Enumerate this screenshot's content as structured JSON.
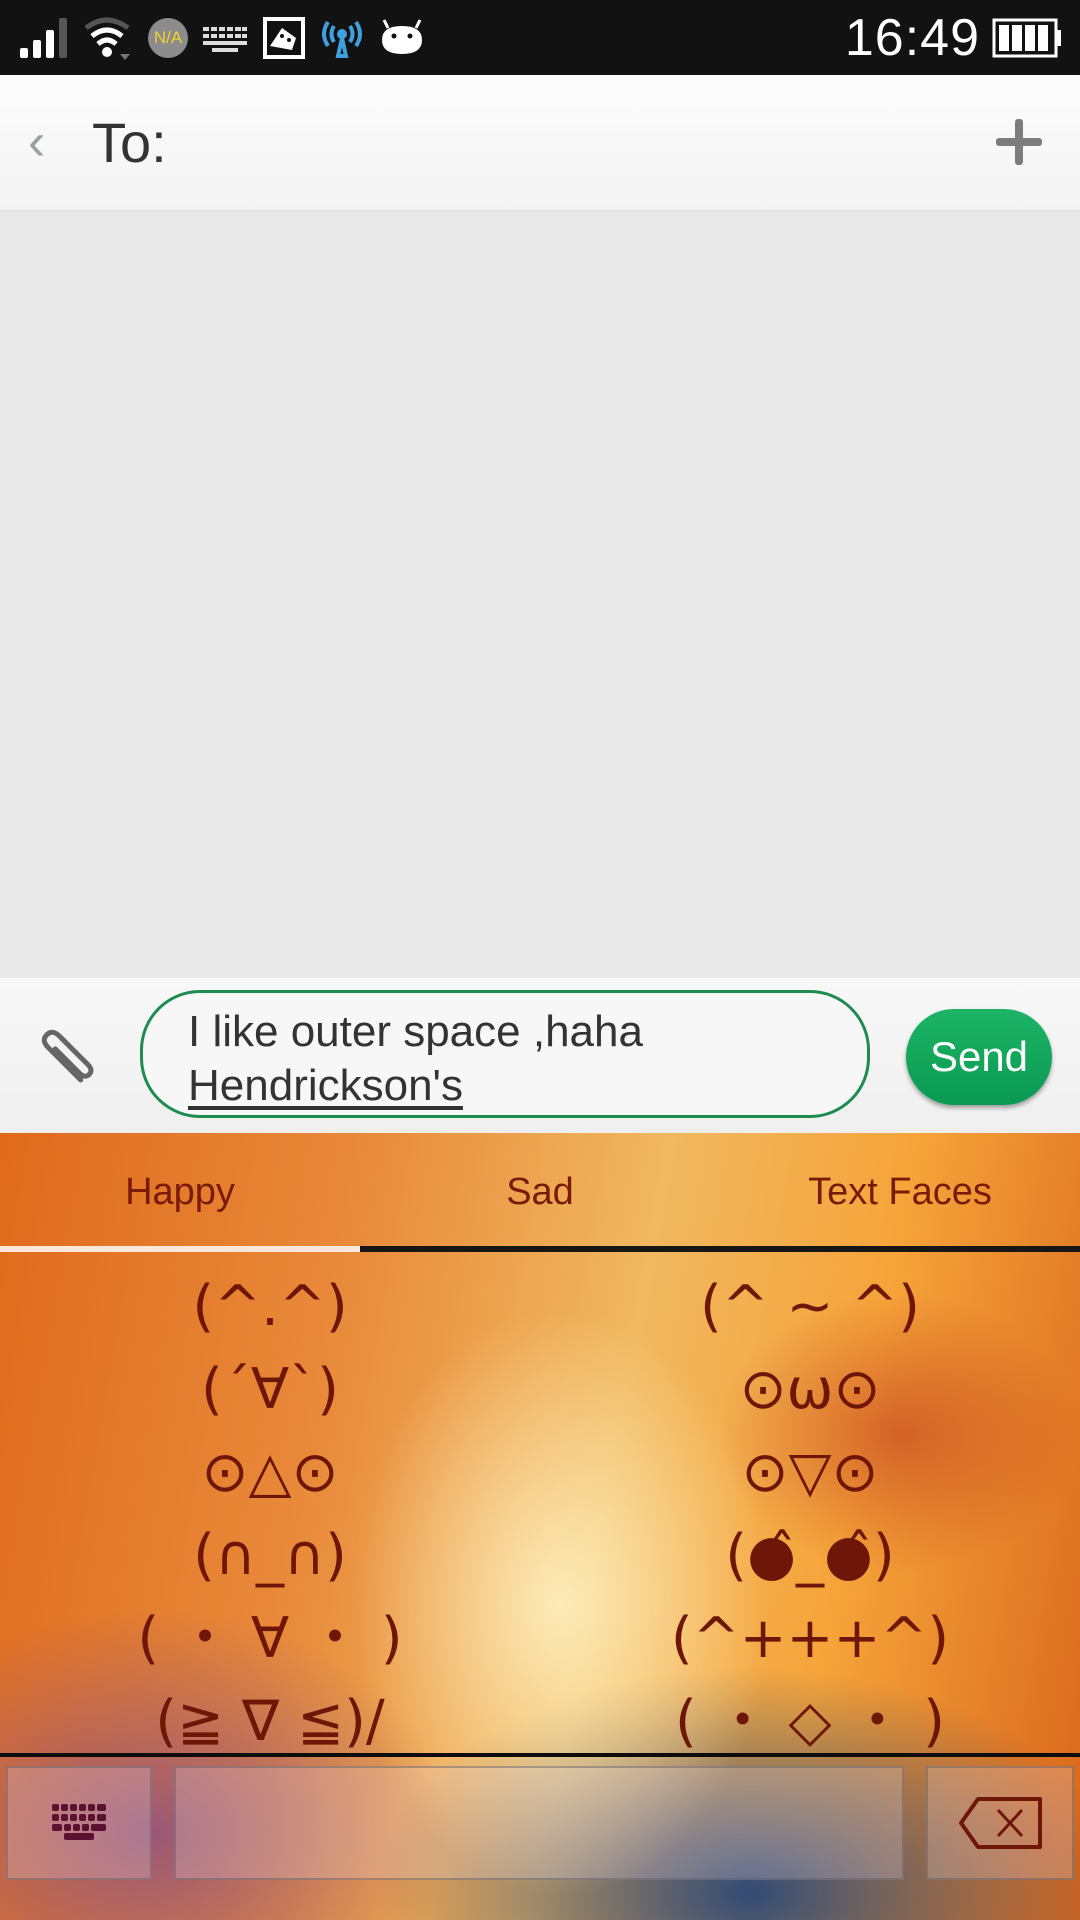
{
  "status_bar": {
    "time": "16:49",
    "icons": [
      "signal-icon",
      "wifi-icon",
      "na-badge-icon",
      "keyboard-icon",
      "android-screenshot-icon",
      "hotspot-icon",
      "android-icon",
      "battery-icon"
    ],
    "na_badge_text": "N/A"
  },
  "header": {
    "back_glyph": "‹",
    "to_label": "To:",
    "add_label": "+"
  },
  "compose": {
    "message_line1": "I like outer space ,haha",
    "message_line2": "Hendrickson's",
    "send_label": "Send",
    "input_border_color": "#1e8c4e",
    "send_color": "#12a85c"
  },
  "emoticon_keyboard": {
    "tabs": [
      {
        "label": "Happy",
        "active": true
      },
      {
        "label": "Sad",
        "active": false
      },
      {
        "label": "Text Faces",
        "active": false
      }
    ],
    "faces_left": [
      "(^.^)",
      "(´∀`)",
      "⊙△⊙",
      "(∩_∩)",
      "( ・ ∀ ・ )",
      "(≧ ∇ ≦)/"
    ],
    "faces_right": [
      "(^ ~ ^)",
      "⊙ω⊙",
      "⊙▽⊙",
      "(●̂_●̂)",
      "(^+++^)",
      "( ・ ◇ ・ )"
    ],
    "text_color": "#6e1608"
  }
}
